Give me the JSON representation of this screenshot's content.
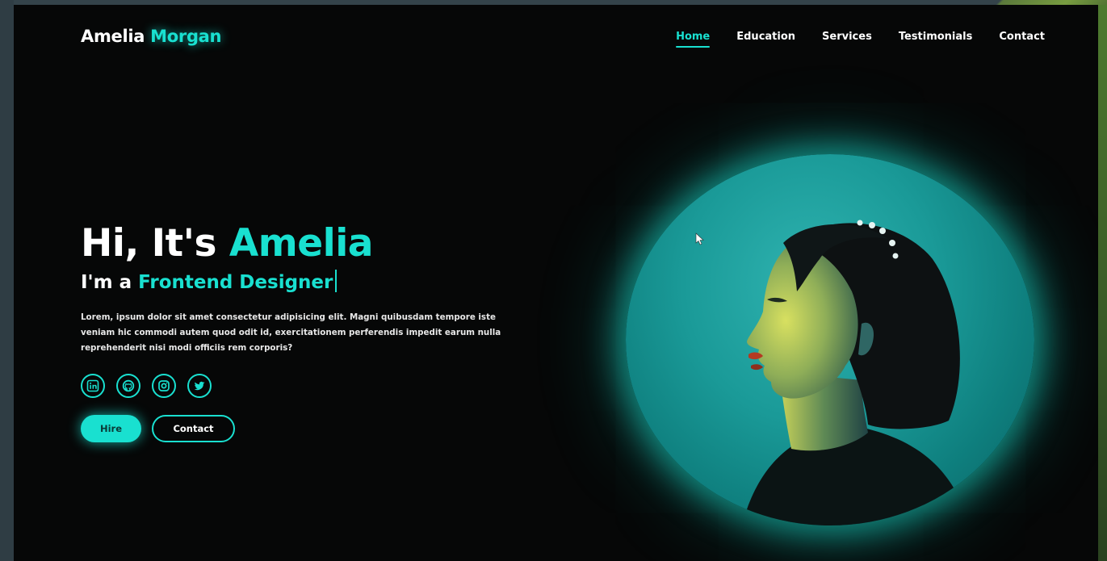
{
  "colors": {
    "accent": "#19e0d0",
    "background": "#060707",
    "text": "#ffffff"
  },
  "brand": {
    "first": "Amelia",
    "last": "Morgan"
  },
  "nav": {
    "items": [
      {
        "label": "Home",
        "active": true
      },
      {
        "label": "Education",
        "active": false
      },
      {
        "label": "Services",
        "active": false
      },
      {
        "label": "Testimonials",
        "active": false
      },
      {
        "label": "Contact",
        "active": false
      }
    ]
  },
  "hero": {
    "greeting": "Hi, It's",
    "name": "Amelia",
    "role_prefix": "I'm a",
    "role": "Frontend Designer",
    "description": "Lorem, ipsum dolor sit amet consectetur adipisicing elit. Magni quibusdam tempore iste veniam hic commodi autem quod odit id, exercitationem perferendis impedit earum nulla reprehenderit nisi modi officiis rem corporis?"
  },
  "socials": [
    {
      "icon": "linkedin-icon"
    },
    {
      "icon": "github-icon"
    },
    {
      "icon": "instagram-icon"
    },
    {
      "icon": "twitter-icon"
    }
  ],
  "buttons": {
    "hire": "Hire",
    "contact": "Contact"
  },
  "portrait": {
    "icon": "profile-photo"
  }
}
